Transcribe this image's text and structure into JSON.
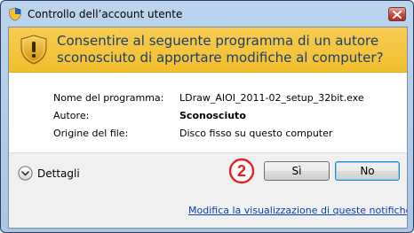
{
  "window": {
    "title": "Controllo dell’account utente"
  },
  "banner": {
    "message": "Consentire al seguente programma di un autore sconosciuto di apportare modifiche al computer?",
    "color": "#f4c43f"
  },
  "details": [
    {
      "label": "Nome del programma:",
      "value": "LDraw_AIOI_2011-02_setup_32bit.exe"
    },
    {
      "label": "Autore:",
      "value": "Sconosciuto"
    },
    {
      "label": "Origine del file:",
      "value": "Disco fisso su questo computer"
    }
  ],
  "footer": {
    "details_toggle": "Dettagli",
    "step_marker": "2",
    "yes_button": "Sì",
    "no_button": "No",
    "link": "Modifica la visualizzazione di queste notifiche"
  },
  "icons": {
    "title": "uac-shield-icon",
    "banner": "warning-shield-icon",
    "toggle": "chevron-down-icon",
    "close": "close-icon"
  },
  "colors": {
    "marker_red": "#e0231c",
    "link_blue": "#0b3db7"
  }
}
